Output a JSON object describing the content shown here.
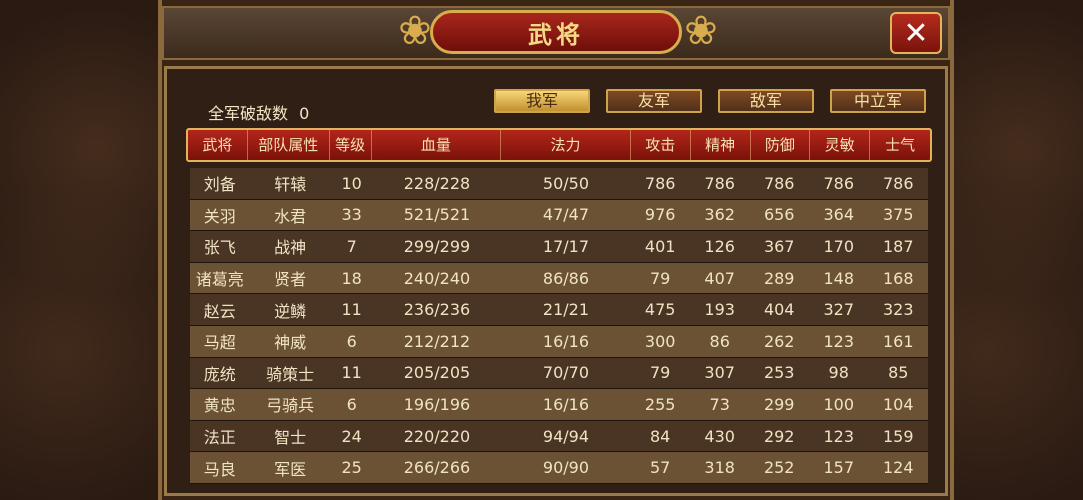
{
  "window": {
    "title": "武将",
    "close_icon": "close-icon"
  },
  "summary": {
    "label": "全军破敌数",
    "value": "0"
  },
  "tabs": [
    {
      "label": "我军",
      "active": true
    },
    {
      "label": "友军",
      "active": false
    },
    {
      "label": "敌军",
      "active": false
    },
    {
      "label": "中立军",
      "active": false
    }
  ],
  "columns": [
    "武将",
    "部队属性",
    "等级",
    "血量",
    "法力",
    "攻击",
    "精神",
    "防御",
    "灵敏",
    "士气"
  ],
  "rows": [
    [
      "刘备",
      "轩辕",
      "10",
      "228/228",
      "50/50",
      "786",
      "786",
      "786",
      "786",
      "786"
    ],
    [
      "关羽",
      "水君",
      "33",
      "521/521",
      "47/47",
      "976",
      "362",
      "656",
      "364",
      "375"
    ],
    [
      "张飞",
      "战神",
      "7",
      "299/299",
      "17/17",
      "401",
      "126",
      "367",
      "170",
      "187"
    ],
    [
      "诸葛亮",
      "贤者",
      "18",
      "240/240",
      "86/86",
      "79",
      "407",
      "289",
      "148",
      "168"
    ],
    [
      "赵云",
      "逆鳞",
      "11",
      "236/236",
      "21/21",
      "475",
      "193",
      "404",
      "327",
      "323"
    ],
    [
      "马超",
      "神威",
      "6",
      "212/212",
      "16/16",
      "300",
      "86",
      "262",
      "123",
      "161"
    ],
    [
      "庞统",
      "骑策士",
      "11",
      "205/205",
      "70/70",
      "79",
      "307",
      "253",
      "98",
      "85"
    ],
    [
      "黄忠",
      "弓骑兵",
      "6",
      "196/196",
      "16/16",
      "255",
      "73",
      "299",
      "100",
      "104"
    ],
    [
      "法正",
      "智士",
      "24",
      "220/220",
      "94/94",
      "84",
      "430",
      "292",
      "123",
      "159"
    ],
    [
      "马良",
      "军医",
      "25",
      "266/266",
      "90/90",
      "57",
      "318",
      "252",
      "157",
      "124"
    ]
  ]
}
